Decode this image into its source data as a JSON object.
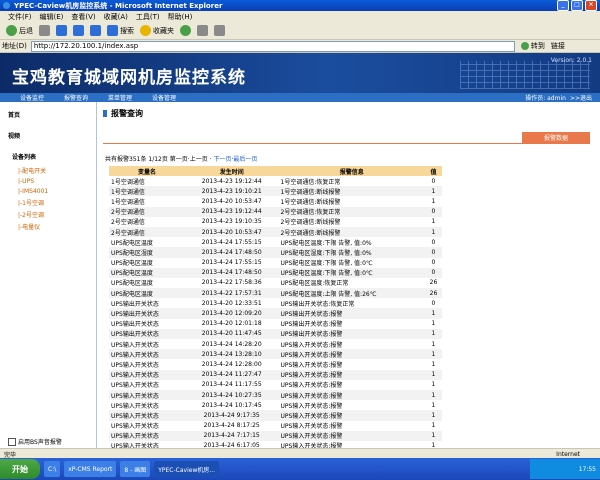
{
  "window": {
    "title": "YPEC-Caview机房监控系统 - Microsoft Internet Explorer",
    "min": "_",
    "max": "□",
    "close": "×"
  },
  "menu": [
    "文件(F)",
    "编辑(E)",
    "查看(V)",
    "收藏(A)",
    "工具(T)",
    "帮助(H)"
  ],
  "toolbar": {
    "back": "后退",
    "search": "搜索",
    "favorites": "收藏夹"
  },
  "address": {
    "label": "地址(D)",
    "url": "http://172.20.100.1/index.asp",
    "go": "转到",
    "links": "链接"
  },
  "banner": {
    "title": "宝鸡教育城域网机房监控系统",
    "version": "Version: 2.0.1"
  },
  "nav": {
    "items": [
      "设备监控",
      "报警查询",
      "菜单管理",
      "设备管理"
    ],
    "user": "操作员: admin",
    "back": ">>退出"
  },
  "sidebar": {
    "home": "首页",
    "video": "视频",
    "tree_header": "设备列表",
    "items": [
      "|-配电开关",
      "|-UPS",
      "|-IMS4001",
      "|-1号空调",
      "|-2号空调",
      "|-电量仪"
    ],
    "sound": "启用BS声音报警"
  },
  "main": {
    "page_title": "报警查询",
    "tag": "报警数据",
    "pager": {
      "total": "共有报警351条",
      "pages": "1/12页",
      "first": "第一页",
      "prev": "上一页",
      "next": "下一页",
      "last": "最后一页"
    },
    "columns": [
      "变量名",
      "发生时间",
      "报警信息",
      "值"
    ],
    "rows": [
      [
        "1号空调通信",
        "2013-4-23 19:12:44",
        "1号空调通信:恢复正常",
        "0"
      ],
      [
        "1号空调通信",
        "2013-4-23 19:10:21",
        "1号空调通信:断线报警",
        "1"
      ],
      [
        "1号空调通信",
        "2013-4-20 10:53:47",
        "1号空调通信:断线报警",
        "1"
      ],
      [
        "2号空调通信",
        "2013-4-23 19:12:44",
        "2号空调通信:恢复正常",
        "0"
      ],
      [
        "2号空调通信",
        "2013-4-23 19:10:35",
        "2号空调通信:断线报警",
        "1"
      ],
      [
        "2号空调通信",
        "2013-4-20 10:53:47",
        "2号空调通信:断线报警",
        "1"
      ],
      [
        "UPS配电区温度",
        "2013-4-24 17:55:15",
        "UPS配电区温度:下限 告警, 值:0%",
        "0"
      ],
      [
        "UPS配电区湿度",
        "2013-4-24 17:48:50",
        "UPS配电区湿度:下限 告警, 值:0%",
        "0"
      ],
      [
        "UPS配电区温度",
        "2013-4-24 17:55:15",
        "UPS配电区温度:下限 告警, 值:0℃",
        "0"
      ],
      [
        "UPS配电区温度",
        "2013-4-24 17:48:50",
        "UPS配电区温度:下限 告警, 值:0℃",
        "0"
      ],
      [
        "UPS配电区温度",
        "2013-4-22 17:58:36",
        "UPS配电区温度:恢复正常",
        "26"
      ],
      [
        "UPS配电区温度",
        "2013-4-22 17:57:31",
        "UPS配电区温度:上限 告警, 值:26℃",
        "26"
      ],
      [
        "UPS输出开关状态",
        "2013-4-20 12:33:51",
        "UPS输出开关状态:恢复正常",
        "0"
      ],
      [
        "UPS输出开关状态",
        "2013-4-20 12:09:20",
        "UPS输出开关状态:报警",
        "1"
      ],
      [
        "UPS输出开关状态",
        "2013-4-20 12:01:18",
        "UPS输出开关状态:报警",
        "1"
      ],
      [
        "UPS输出开关状态",
        "2013-4-20 11:47:45",
        "UPS输出开关状态:报警",
        "1"
      ],
      [
        "UPS输入开关状态",
        "2013-4-24 14:28:20",
        "UPS输入开关状态:报警",
        "1"
      ],
      [
        "UPS输入开关状态",
        "2013-4-24 13:28:10",
        "UPS输入开关状态:报警",
        "1"
      ],
      [
        "UPS输入开关状态",
        "2013-4-24 12:28:00",
        "UPS输入开关状态:报警",
        "1"
      ],
      [
        "UPS输入开关状态",
        "2013-4-24 11:27:47",
        "UPS输入开关状态:报警",
        "1"
      ],
      [
        "UPS输入开关状态",
        "2013-4-24 11:17:55",
        "UPS输入开关状态:报警",
        "1"
      ],
      [
        "UPS输入开关状态",
        "2013-4-24 10:27:35",
        "UPS输入开关状态:报警",
        "1"
      ],
      [
        "UPS输入开关状态",
        "2013-4-24 10:17:45",
        "UPS输入开关状态:报警",
        "1"
      ],
      [
        "UPS输入开关状态",
        "2013-4-24 9:17:35",
        "UPS输入开关状态:报警",
        "1"
      ],
      [
        "UPS输入开关状态",
        "2013-4-24 8:17:25",
        "UPS输入开关状态:报警",
        "1"
      ],
      [
        "UPS输入开关状态",
        "2013-4-24 7:17:15",
        "UPS输入开关状态:报警",
        "1"
      ],
      [
        "UPS输入开关状态",
        "2013-4-24 6:17:05",
        "UPS输入开关状态:报警",
        "1"
      ],
      [
        "UPS输入开关状态",
        "2013-4-24 5:16:55",
        "UPS输入开关状态:报警",
        "1"
      ]
    ]
  },
  "status": {
    "left": "完毕",
    "zone": "Internet"
  },
  "taskbar": {
    "start": "开始",
    "items": [
      "C:\\",
      "xP-CMS Report",
      "8 - 画图",
      "YPEC-Caview机房..."
    ],
    "clock": "17:55"
  }
}
